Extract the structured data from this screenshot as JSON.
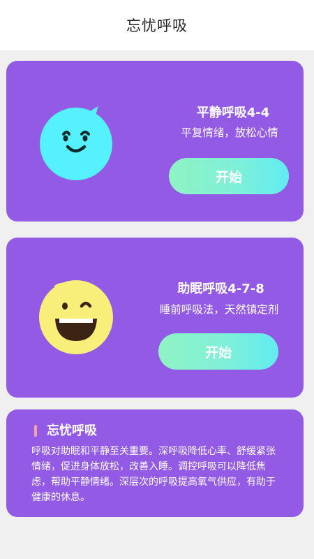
{
  "header": {
    "title": "忘忧呼吸"
  },
  "cards": [
    {
      "title": "平静呼吸4-4",
      "subtitle": "平复情绪，放松心情",
      "button_label": "开始",
      "face": "calm-smile-face-icon",
      "face_color": "#55f1ff"
    },
    {
      "title": "助眠呼吸4-7-8",
      "subtitle": "睡前呼吸法，天然镇定剂",
      "button_label": "开始",
      "face": "laughing-face-icon",
      "face_color": "#f7ef79"
    }
  ],
  "info": {
    "title": "忘忧呼吸",
    "body": "呼吸对助眠和平静至关重要。深呼吸降低心率、舒缓紧张情绪，促进身体放松，改善入睡。调控呼吸可以降低焦虑，帮助平静情绪。深层次的呼吸提高氧气供应，有助于健康的休息。"
  },
  "colors": {
    "card_bg": "#935ae6",
    "page_bg": "#f0f0f0",
    "button_gradient_start": "#8ff3c4",
    "button_gradient_end": "#62ecf2",
    "accent_bar": "#f6a2a2"
  }
}
